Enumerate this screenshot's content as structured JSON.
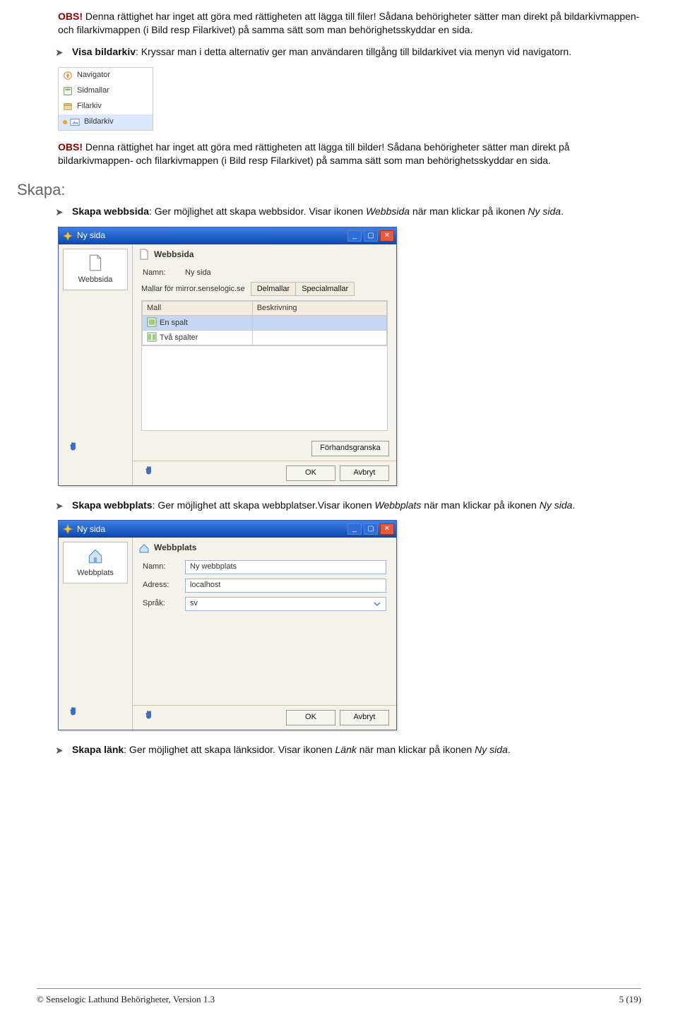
{
  "para1": {
    "obs": "OBS!",
    "text": " Denna rättighet har inget att göra med rättigheten att lägga till filer! Sådana behörigheter sätter man direkt på bildarkivmappen- och filarkivmappen (i Bild resp Filarkivet) på samma sätt som man behörighetsskyddar en sida."
  },
  "bullet_visa": {
    "lead": "Visa bildarkiv",
    "rest": ": Kryssar man i detta alternativ ger man användaren tillgång till bildarkivet via menyn vid navigatorn."
  },
  "nav_menu": [
    "Navigator",
    "Sidmallar",
    "Filarkiv",
    "Bildarkiv"
  ],
  "para2": {
    "obs": "OBS!",
    "text": " Denna rättighet har inget att göra med rättigheten att lägga till bilder! Sådana behörigheter sätter man direkt på  bildarkivmappen- och filarkivmappen (i Bild resp Filarkivet) på samma sätt som man behörighetsskyddar en sida."
  },
  "skapa_heading": "Skapa:",
  "bullet_skapa_webbsida": {
    "lead": "Skapa webbsida",
    "mid": ": Ger möjlighet att skapa webbsidor. Visar ikonen ",
    "em1": "Webbsida",
    "mid2": " när man klickar på ikonen ",
    "em2": "Ny sida",
    "tail": "."
  },
  "dlg1": {
    "title": "Ny sida",
    "side_label": "Webbsida",
    "hdr": "Webbsida",
    "name_label": "Namn:",
    "name_value": "Ny sida",
    "tabs_label": "Mallar för mirror.senselogic.se",
    "tab2": "Delmallar",
    "tab3": "Specialmallar",
    "col1": "Mall",
    "col2": "Beskrivning",
    "row1": "En spalt",
    "row2": "Två spalter",
    "preview_btn": "Förhandsgranska",
    "ok": "OK",
    "cancel": "Avbryt"
  },
  "bullet_skapa_webbplats": {
    "lead": "Skapa webbplats",
    "mid": ": Ger möjlighet att skapa webbplatser.Visar ikonen ",
    "em1": "Webbplats",
    "mid2": " när man klickar på ikonen ",
    "em2": "Ny sida",
    "tail": "."
  },
  "dlg2": {
    "title": "Ny sida",
    "side_label": "Webbplats",
    "hdr": "Webbplats",
    "name_label": "Namn:",
    "name_value": "Ny webbplats",
    "addr_label": "Adress:",
    "addr_value": "localhost",
    "lang_label": "Språk:",
    "lang_value": "sv",
    "ok": "OK",
    "cancel": "Avbryt"
  },
  "bullet_skapa_lank": {
    "lead": "Skapa länk",
    "mid": ": Ger möjlighet att skapa länksidor. Visar ikonen ",
    "em1": "Länk",
    "mid2": " när man klickar på ikonen ",
    "em2": "Ny sida",
    "tail": "."
  },
  "footer_left": "© Senselogic Lathund Behörigheter, Version 1.3",
  "footer_right": "5 (19)"
}
